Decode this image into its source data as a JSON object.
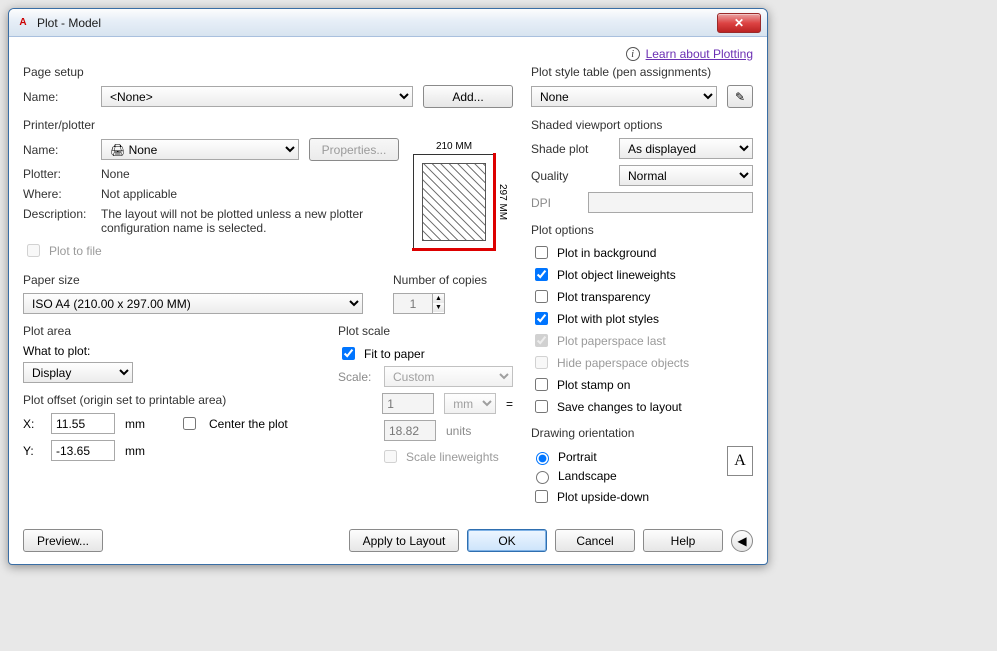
{
  "window": {
    "title": "Plot - Model"
  },
  "top": {
    "learn": "Learn about Plotting"
  },
  "pageSetup": {
    "legend": "Page setup",
    "nameLabel": "Name:",
    "nameValue": "<None>",
    "addBtn": "Add..."
  },
  "printer": {
    "legend": "Printer/plotter",
    "nameLabel": "Name:",
    "nameValue": "None",
    "propertiesBtn": "Properties...",
    "plotterLabel": "Plotter:",
    "plotterValue": "None",
    "whereLabel": "Where:",
    "whereValue": "Not applicable",
    "descLabel": "Description:",
    "descValue": "The layout will not be plotted unless a new plotter configuration name is selected.",
    "plotToFileLabel": "Plot to file",
    "preview": {
      "widthText": "210 MM",
      "heightText": "297 MM"
    }
  },
  "paper": {
    "sizeLabel": "Paper size",
    "sizeValue": "ISO A4 (210.00 x 297.00 MM)",
    "copiesLabel": "Number of copies",
    "copiesValue": "1"
  },
  "plotArea": {
    "legend": "Plot area",
    "whatLabel": "What to plot:",
    "whatValue": "Display"
  },
  "plotOffset": {
    "legend": "Plot offset (origin set to printable area)",
    "xLabel": "X:",
    "xValue": "11.55",
    "xUnit": "mm",
    "yLabel": "Y:",
    "yValue": "-13.65",
    "yUnit": "mm",
    "centerLabel": "Center the plot"
  },
  "plotScale": {
    "legend": "Plot scale",
    "fitLabel": "Fit to paper",
    "scaleLabel": "Scale:",
    "scaleValue": "Custom",
    "num": "1",
    "numUnit": "mm",
    "equals": "=",
    "den": "18.82",
    "denUnit": "units",
    "scaleLwLabel": "Scale lineweights"
  },
  "styleTable": {
    "legend": "Plot style table (pen assignments)",
    "value": "None"
  },
  "shaded": {
    "legend": "Shaded viewport options",
    "shadeLabel": "Shade plot",
    "shadeValue": "As displayed",
    "qualityLabel": "Quality",
    "qualityValue": "Normal",
    "dpiLabel": "DPI",
    "dpiValue": ""
  },
  "options": {
    "legend": "Plot options",
    "bg": "Plot in background",
    "lw": "Plot object lineweights",
    "trans": "Plot transparency",
    "styles": "Plot with plot styles",
    "paperspaceLast": "Plot paperspace last",
    "hidePs": "Hide paperspace objects",
    "stamp": "Plot stamp on",
    "save": "Save changes to layout"
  },
  "orient": {
    "legend": "Drawing orientation",
    "portrait": "Portrait",
    "landscape": "Landscape",
    "upside": "Plot upside-down"
  },
  "footer": {
    "preview": "Preview...",
    "apply": "Apply to Layout",
    "ok": "OK",
    "cancel": "Cancel",
    "help": "Help"
  }
}
